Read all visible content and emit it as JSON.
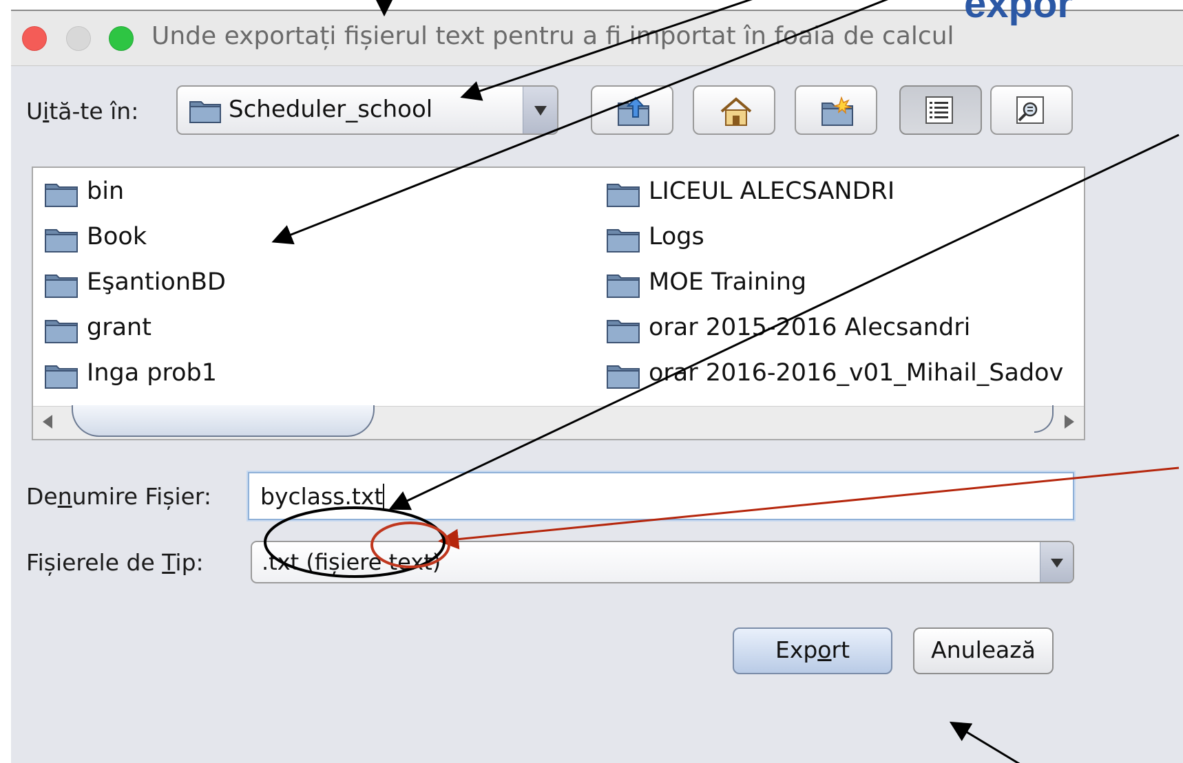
{
  "slide": {
    "heading": "expor"
  },
  "window": {
    "title": "Unde exportați fișierul text pentru a fi importat în foaia de calcul"
  },
  "look_in": {
    "label_pre": "U",
    "label_mnemonic": "i",
    "label_post": "tă-te în:",
    "value": "Scheduler_school"
  },
  "toolbar": {
    "up_icon": "up-folder-icon",
    "home_icon": "home-icon",
    "new_folder_icon": "new-folder-icon",
    "list_icon": "list-view-icon",
    "details_icon": "details-view-icon"
  },
  "files": {
    "col1": [
      "bin",
      "Book",
      "EşantionBD",
      "grant",
      "Inga prob1"
    ],
    "col2": [
      "LICEUL ALECSANDRI",
      "Logs",
      "MOE Training",
      "orar 2015-2016 Alecsandri",
      "orar 2016-2016_v01_Mihail_Sadov"
    ]
  },
  "file_name": {
    "label_pre": "De",
    "label_mnemonic": "n",
    "label_post": "umire Fișier:",
    "value": "byclass.txt"
  },
  "file_type": {
    "label_pre": "Fișierele de ",
    "label_mnemonic": "T",
    "label_post": "ip:",
    "value": ".txt (fișiere text)"
  },
  "buttons": {
    "export_pre": "Exp",
    "export_mnemonic": "o",
    "export_post": "rt",
    "cancel": "Anulează"
  },
  "colors": {
    "arrow_black": "#000000",
    "arrow_red": "#b5260c",
    "highlight_red": "#c0371e",
    "heading_blue": "#2b58a5"
  }
}
